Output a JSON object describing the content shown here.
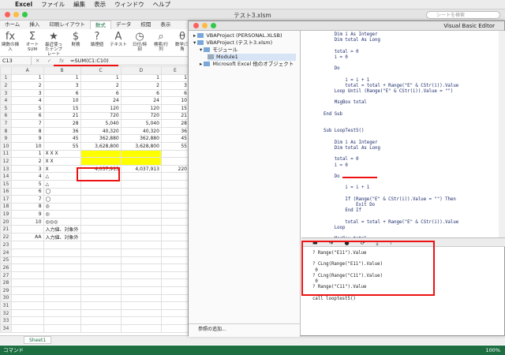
{
  "menubar": {
    "app": "Excel",
    "items": [
      "ファイル",
      "編集",
      "表示",
      "ウィンドウ",
      "ヘルプ"
    ]
  },
  "window": {
    "title": "テスト3.xlsm",
    "search_placeholder": "シートを検索"
  },
  "tabs": [
    "ホーム",
    "挿入",
    "印刷レイアウト",
    "数式",
    "データ",
    "校閲",
    "表示"
  ],
  "active_tab": "数式",
  "ribbon": [
    {
      "icon": "fx",
      "label": "関数の挿入"
    },
    {
      "icon": "Σ",
      "label": "オートSUM"
    },
    {
      "icon": "★",
      "label": "最近使ったテンプレート"
    },
    {
      "icon": "$",
      "label": "財務"
    },
    {
      "icon": "?",
      "label": "論理値"
    },
    {
      "icon": "A",
      "label": "テキスト"
    },
    {
      "icon": "◷",
      "label": "日付/時刻"
    },
    {
      "icon": "⌕",
      "label": "検索/行列"
    },
    {
      "icon": "θ",
      "label": "数学/三角"
    }
  ],
  "formula_bar": {
    "cell": "C13",
    "formula": "=SUM(C1:C10)"
  },
  "grid": {
    "columns": [
      "",
      "A",
      "B",
      "C",
      "D",
      "E"
    ],
    "rows": [
      [
        "1",
        "1",
        "1",
        "1",
        "1",
        "1"
      ],
      [
        "2",
        "2",
        "3",
        "2",
        "2",
        "3"
      ],
      [
        "3",
        "3",
        "6",
        "6",
        "6",
        "6"
      ],
      [
        "4",
        "4",
        "10",
        "24",
        "24",
        "10"
      ],
      [
        "5",
        "5",
        "15",
        "120",
        "120",
        "15"
      ],
      [
        "6",
        "6",
        "21",
        "720",
        "720",
        "21"
      ],
      [
        "7",
        "7",
        "28",
        "5,040",
        "5,040",
        "28"
      ],
      [
        "8",
        "8",
        "36",
        "40,320",
        "40,320",
        "36"
      ],
      [
        "9",
        "9",
        "45",
        "362,880",
        "362,880",
        "45"
      ],
      [
        "10",
        "10",
        "55",
        "3,628,800",
        "3,628,800",
        "55"
      ],
      [
        "11",
        "1",
        "X X X",
        "",
        "",
        ""
      ],
      [
        "12",
        "2",
        "X X",
        "",
        "",
        ""
      ],
      [
        "13",
        "3",
        "X",
        "4,037,913",
        "4,037,913",
        "220"
      ],
      [
        "14",
        "4",
        "△",
        "",
        "",
        ""
      ],
      [
        "15",
        "5",
        "△",
        "",
        "",
        ""
      ],
      [
        "16",
        "6",
        "◯",
        "",
        "",
        ""
      ],
      [
        "17",
        "7",
        "◯",
        "",
        "",
        ""
      ],
      [
        "18",
        "8",
        "◎",
        "",
        "",
        ""
      ],
      [
        "19",
        "9",
        "◎",
        "",
        "",
        ""
      ],
      [
        "20",
        "10",
        "◎◎◎",
        "",
        "",
        ""
      ],
      [
        "21",
        "",
        "入力値、対象外",
        "",
        "",
        ""
      ],
      [
        "22",
        "AA",
        "入力値、対象外",
        "",
        "",
        ""
      ],
      [
        "23",
        "",
        "",
        "",
        "",
        ""
      ],
      [
        "24",
        "",
        "",
        "",
        "",
        ""
      ],
      [
        "25",
        "",
        "",
        "",
        "",
        ""
      ],
      [
        "26",
        "",
        "",
        "",
        "",
        ""
      ],
      [
        "27",
        "",
        "",
        "",
        "",
        ""
      ],
      [
        "28",
        "",
        "",
        "",
        "",
        ""
      ],
      [
        "29",
        "",
        "",
        "",
        "",
        ""
      ],
      [
        "30",
        "",
        "",
        "",
        "",
        ""
      ],
      [
        "31",
        "",
        "",
        "",
        "",
        ""
      ],
      [
        "32",
        "",
        "",
        "",
        "",
        ""
      ],
      [
        "33",
        "",
        "",
        "",
        "",
        ""
      ],
      [
        "34",
        "",
        "",
        "",
        "",
        ""
      ]
    ]
  },
  "sheet_tab": "Sheet1",
  "status": {
    "mode": "コマンド",
    "zoom": "100%"
  },
  "vbe": {
    "title": "Visual Basic Editor",
    "project_items": [
      "VBAProject (PERSONAL.XLSB)",
      "VBAProject (テスト3.xlsm)",
      "モジュール",
      "Module1",
      "Microsoft Excel 他のオブジェクト"
    ],
    "references": "参照の追加...",
    "code": "    Dim i As Integer\n    Dim total As Long\n\n    total = 0\n    i = 0\n\n    Do\n\n        i = i + 1\n        total = total + Range(\"E\" & CStr(i)).Value\n    Loop Until (Range(\"E\" & CStr(i)).Value = \"\")\n\n    MsgBox total\n\nEnd Sub\n\n\nSub LoopTest5()\n\n    Dim i As Integer\n    Dim total As Long\n\n    total = 0\n    i = 0\n\n    Do\n\n        i = i + 1\n\n        If (Range(\"E\" & CStr(i)).Value = \"\") Then\n            Exit Do\n        End If\n\n        total = total + Range(\"E\" & CStr(i)).Value\n    Loop\n\n    MsgBox total\n\nEnd Sub",
    "immediate": "? Range(\"E11\").Value\n\n? CLng(Range(\"E11\").Value)\n 0\n? CLng(Range(\"C11\").Value)\n 0\n? Range(\"C11\").Value\n\ncall looptest5()"
  }
}
